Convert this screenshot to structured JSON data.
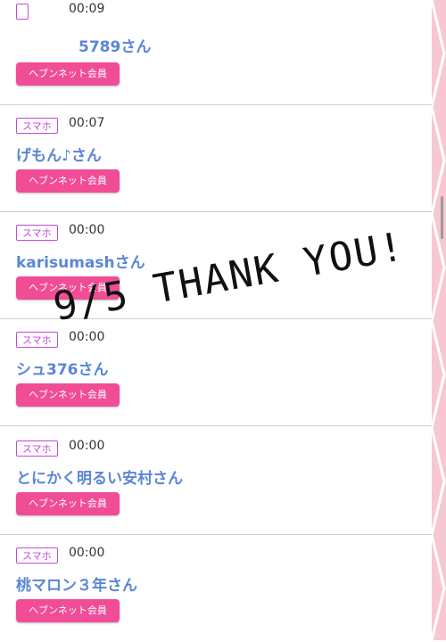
{
  "entries": [
    {
      "device": "",
      "time": "00:09",
      "name": "5789さん",
      "member": "ヘブンネット会員"
    },
    {
      "device": "スマホ",
      "time": "00:07",
      "name": "げもん♪さん",
      "member": "ヘブンネット会員"
    },
    {
      "device": "スマホ",
      "time": "00:00",
      "name": "karisumashさん",
      "member": "ヘブンネット会員"
    },
    {
      "device": "スマホ",
      "time": "00:00",
      "name": "シュ376さん",
      "member": "ヘブンネット会員"
    },
    {
      "device": "スマホ",
      "time": "00:00",
      "name": "とにかく明るい安村さん",
      "member": "ヘブンネット会員"
    },
    {
      "device": "スマホ",
      "time": "00:00",
      "name": "桃マロン３年さん",
      "member": "ヘブンネット会員"
    }
  ],
  "overlay": {
    "text": "9/5 THANK YOU!"
  },
  "colors": {
    "accent_pink": "#f04d96",
    "badge_purple": "#c24ad6",
    "name_blue": "#5a86d6"
  }
}
